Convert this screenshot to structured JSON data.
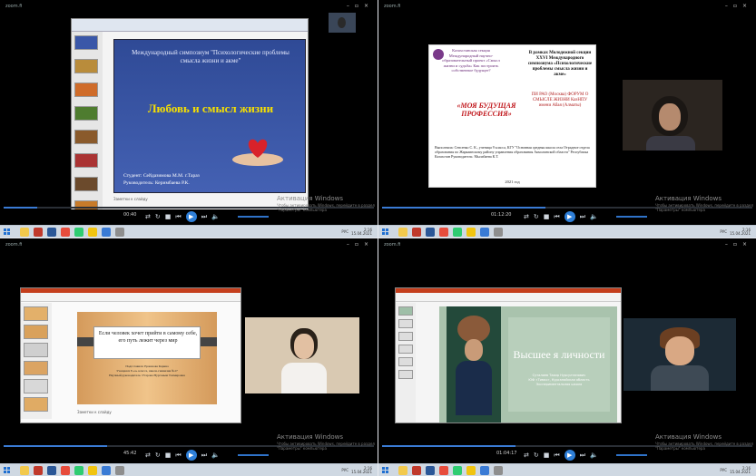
{
  "q1": {
    "window_title": "zoom.fi",
    "slide_title": "Международный симпозиум \"Психологические проблемы смысла жизни и акме\"",
    "slide_heading": "Любовь и смысл жизни",
    "student_line": "Студент: Сейдазимова М.М.   г.Тараз",
    "supervisor_line": "Руководитель: Керимбаева Р.К.",
    "notes_hint": "Заметки к слайду",
    "time": "00:40"
  },
  "q2": {
    "window_title": "zoom.fi",
    "left_block": "Казахстанская секция Международный научно-образовательный проект «Смысл жизни и судьба» Как построить собственное будущее?",
    "right_block": "В рамках Молодежной секции XXVI Международного симпозиума «Психологические проблемы смысла жизни и акме»",
    "org_block": "ПИ РАО (Москва) ФОРУМ О СМЫСЛЕ ЖИЗНИ КазНПУ имени Абая (Алматы)",
    "title_text": "«МОЯ БУДУЩАЯ ПРОФЕССИЯ»",
    "footer_text": "Выполнила: Севсенко С. К., ученица 9 класса, КГУ \"Основная средняя школа села Отрадное отдела образования по Жаркаинскому району управления образования Акмолинской области\" Республика Казахстан Руководитель: Мылабаева К.Т.",
    "year": "2021 год",
    "time": "01:12:20"
  },
  "q3": {
    "window_title": "zoom.fi",
    "slide_quote": "Если человек хочет прийти в самому себе, его путь лежит через мир",
    "slide_sub1": "Подготовила: Ержанова Карина",
    "slide_sub2": "Учащаяся 8 «а» класса, школа-гимназия №17",
    "slide_sub3": "Научный руководитель: Утарова Нурганым Тахмировна",
    "notes_hint": "Заметки к слайду",
    "time": "45:42"
  },
  "q4": {
    "window_title": "zoom.fi",
    "slide_heading": "Высшее я личности",
    "author_line1": "Суталиев Тахир Нурсултанович",
    "author_line2": "ЮФ «Тимкс», Курсанайская область",
    "author_line3": "Экспериментальная школа",
    "time": "01:04:17"
  },
  "activation": {
    "title": "Активация Windows",
    "sub": "Чтобы активировать Windows, перейдите в раздел \"Параметры\" компьютера"
  },
  "tray": {
    "lang": "РУС",
    "clock": "2:16",
    "date": "15.04.2021"
  },
  "colors": {
    "player_blue": "#2e7fd8",
    "taskbar": "#cfd8e2",
    "slide1_bg": "#3a57a8",
    "slide1_heading": "#f7e000"
  }
}
